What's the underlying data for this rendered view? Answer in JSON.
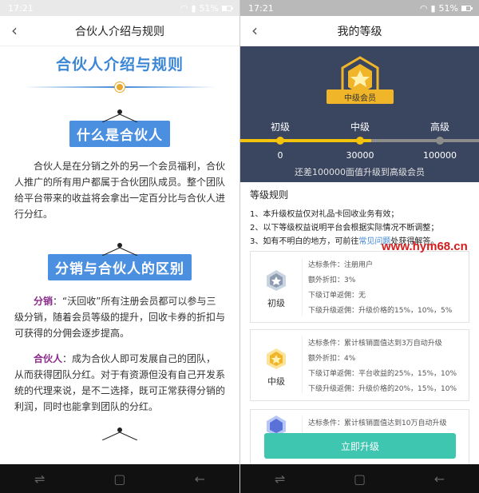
{
  "left": {
    "status": {
      "time": "17:21",
      "battery": "51%"
    },
    "nav": {
      "title": "合伙人介绍与规则"
    },
    "heading": "合伙人介绍与规则",
    "section1": {
      "label": "什么是合伙人",
      "text": "合伙人是在分销之外的另一个会员福利，合伙人推广的所有用户都属于合伙团队成员。整个团队给平台带来的收益将会拿出一定百分比与合伙人进行分红。"
    },
    "section2": {
      "label": "分销与合伙人的区别",
      "p1_kw": "分销",
      "p1_text": "：“沃回收”所有注册会员都可以参与三级分销，随着会员等级的提升，回收卡券的折扣与可获得的分佣会逐步提高。",
      "p2_kw": "合伙人",
      "p2_text": "：成为合伙人即可发展自己的团队，从而获得团队分红。对于有资源但没有自己开发系统的代理来说，是不二选择，既可正常获得分销的利润，同时也能拿到团队的分红。"
    }
  },
  "right": {
    "status": {
      "time": "17:21",
      "battery": "51%"
    },
    "nav": {
      "title": "我的等级"
    },
    "badge_label": "中级会员",
    "levels": [
      {
        "name": "初级",
        "value": "0"
      },
      {
        "name": "中级",
        "value": "30000"
      },
      {
        "name": "高级",
        "value": "100000"
      }
    ],
    "progress_fraction": 0.55,
    "hint": "还差100000面值升级到高级会员",
    "rules": {
      "title": "等级规则",
      "items": [
        "1、本升级权益仅对礼品卡回收业务有效；",
        "2、以下等级权益说明平台会根据实际情况不断调整；",
        "3、如有不明白的地方，可前往"
      ],
      "link": "常见问题",
      "item3_suffix": "处获得解答。"
    },
    "cards": [
      {
        "name": "初级",
        "lines": [
          "达标条件：注册用户",
          "额外折扣：3%",
          "下级订单返佣：无",
          "下级升级返佣：升级价格的15%，10%，5%"
        ]
      },
      {
        "name": "中级",
        "lines": [
          "达标条件：累计核销面值达到3万自动升级",
          "额外折扣：4%",
          "下级订单返佣：平台收益的25%，15%，10%",
          "下级升级返佣：升级价格的20%，15%，10%"
        ]
      },
      {
        "name": "",
        "lines": [
          "达标条件：累计核销面值达到10万自动升级"
        ]
      }
    ],
    "upgrade_button": "立即升级"
  },
  "watermark": "www.hym68.cn",
  "colors": {
    "accent_blue": "#3c86d6",
    "hero_bg": "#3a4560",
    "gold": "#f0b528",
    "teal": "#3ec6b1"
  }
}
